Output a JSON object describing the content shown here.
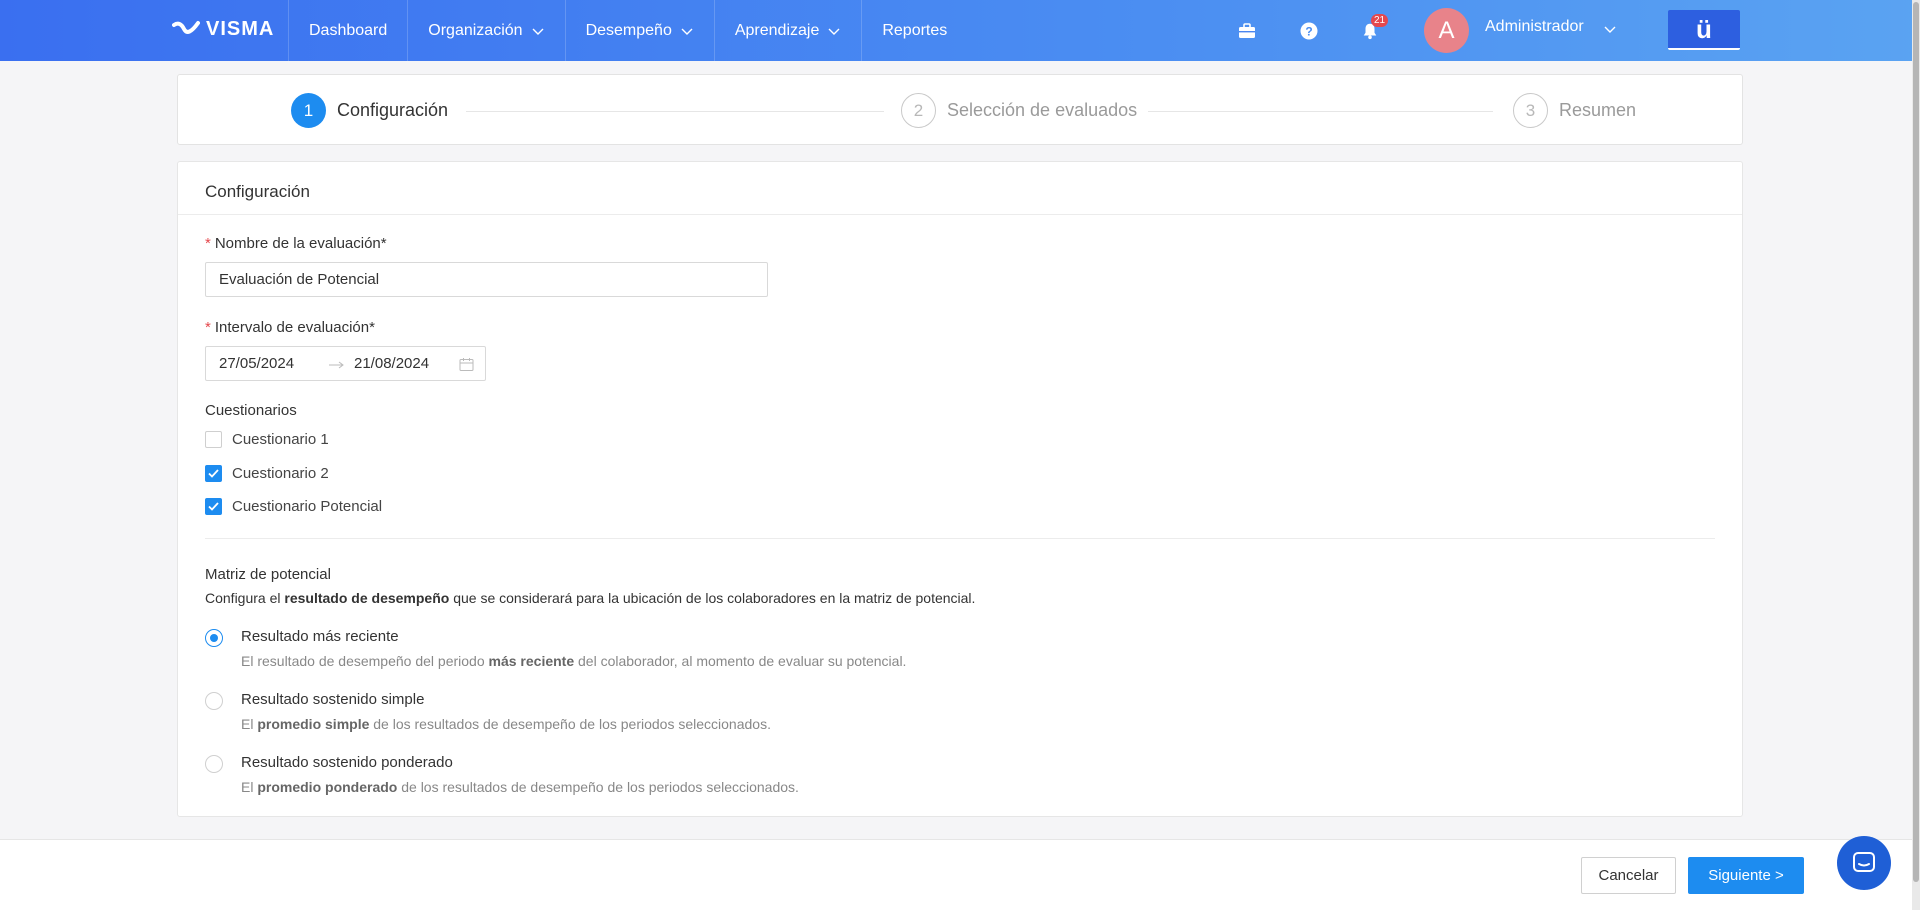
{
  "brand": {
    "name": "VISMA",
    "logo_icon": "visma-swoosh-icon"
  },
  "nav": {
    "items": [
      {
        "label": "Dashboard",
        "has_dropdown": false
      },
      {
        "label": "Organización",
        "has_dropdown": true
      },
      {
        "label": "Desempeño",
        "has_dropdown": true
      },
      {
        "label": "Aprendizaje",
        "has_dropdown": true
      },
      {
        "label": "Reportes",
        "has_dropdown": false
      }
    ]
  },
  "top_icons": {
    "briefcase": "briefcase-icon",
    "help": "help-icon",
    "bell": "bell-icon",
    "notification_count": "21"
  },
  "user": {
    "avatar_letter": "A",
    "name": "Administrador",
    "app_button": "ü"
  },
  "steps": [
    {
      "number": "1",
      "label": "Configuración",
      "state": "active"
    },
    {
      "number": "2",
      "label": "Selección de evaluados",
      "state": "idle"
    },
    {
      "number": "3",
      "label": "Resumen",
      "state": "idle"
    }
  ],
  "form": {
    "card_title": "Configuración",
    "name_label": "Nombre de la evaluación*",
    "name_value": "Evaluación de Potencial",
    "interval_label": "Intervalo de evaluación*",
    "start_date": "27/05/2024",
    "end_date": "21/08/2024",
    "questionnaires_title": "Cuestionarios",
    "questionnaires": [
      {
        "label": "Cuestionario 1",
        "checked": false
      },
      {
        "label": "Cuestionario 2",
        "checked": true
      },
      {
        "label": "Cuestionario Potencial",
        "checked": true
      }
    ],
    "matrix_title": "Matriz de potencial",
    "matrix_desc_prefix": "Configura el ",
    "matrix_desc_bold": "resultado de desempeño",
    "matrix_desc_suffix": " que se considerará para la ubicación de los colaboradores en la matriz de potencial.",
    "options": [
      {
        "title": "Resultado más reciente",
        "desc_prefix": "El resultado de desempeño del periodo ",
        "desc_bold": "más reciente",
        "desc_suffix": " del colaborador, al momento de evaluar su potencial.",
        "selected": true
      },
      {
        "title": "Resultado sostenido simple",
        "desc_prefix": "El ",
        "desc_bold": "promedio simple",
        "desc_suffix": " de los resultados de desempeño de los periodos seleccionados.",
        "selected": false
      },
      {
        "title": "Resultado sostenido ponderado",
        "desc_prefix": "El ",
        "desc_bold": "promedio ponderado",
        "desc_suffix": " de los resultados de desempeño de los periodos seleccionados.",
        "selected": false
      }
    ]
  },
  "footer": {
    "cancel_label": "Cancelar",
    "next_label": "Siguiente >"
  },
  "colors": {
    "primary": "#1d8cf0",
    "nav_start": "#3a6ff0",
    "nav_end": "#5aa3f2",
    "required": "#e5484d",
    "avatar": "#e8838a"
  }
}
